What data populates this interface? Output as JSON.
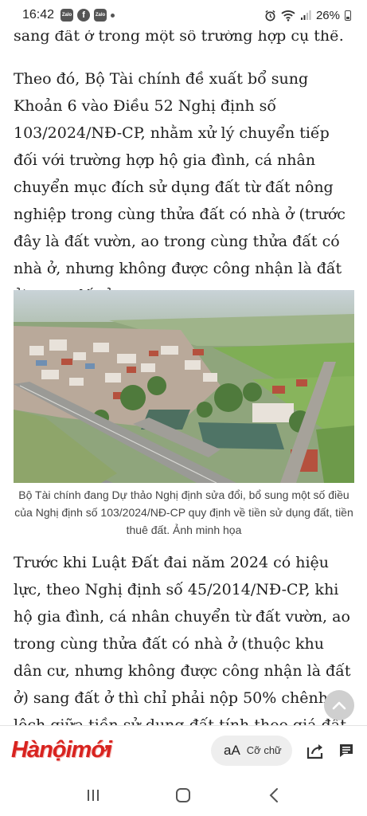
{
  "status_bar": {
    "time": "16:42",
    "apps": [
      "zalo-icon",
      "facebook-icon",
      "zalo-icon",
      "dot-icon"
    ],
    "zalo_label": "Zalo",
    "fb_label": "f",
    "battery": "26%"
  },
  "article": {
    "top_line": "sang đất ở trong một số trường hợp cụ thể.",
    "paragraph_1": "Theo đó, Bộ Tài chính đề xuất bổ sung Khoản 6 vào Điều 52 Nghị định số 103/2024/NĐ-CP, nhằm xử lý chuyển tiếp đối với trường hợp hộ gia đình, cá nhân chuyển mục đích sử dụng đất từ đất nông nghiệp trong cùng thửa đất có nhà ở (trước đây là đất vườn, ao trong cùng thửa đất có nhà ở, nhưng không được công nhận là đất ở) sang đất ở.",
    "image_caption": "Bộ Tài chính đang Dự thảo Nghị định sửa đổi, bổ sung một số điều của Nghị định số 103/2024/NĐ-CP quy định về tiền sử dụng đất, tiền thuê đất. Ảnh minh họa",
    "paragraph_2": "Trước khi Luật Đất đai năm 2024 có hiệu lực, theo Nghị định số 45/2014/NĐ-CP, khi hộ gia đình, cá nhân chuyển từ đất vườn, ao trong cùng thửa đất có nhà ở (thuộc khu dân cư, nhưng không được công nhận là đất ở) sang đất ở thì chỉ phải nộp 50% chênh lệch giữa tiền sử dụng đất tính theo giá đất ở và giá đất"
  },
  "toolbar": {
    "logo": "Hànộimới",
    "aa": "aA",
    "font_size_label": "Cỡ chữ"
  },
  "icons": {
    "scroll_up": "chevron-up-icon",
    "share": "share-icon",
    "comment": "comment-icon",
    "recent": "recent-apps-icon",
    "home": "home-icon",
    "back": "back-icon"
  },
  "colors": {
    "brand": "#d8231f",
    "pill_bg": "#eeeeee"
  }
}
